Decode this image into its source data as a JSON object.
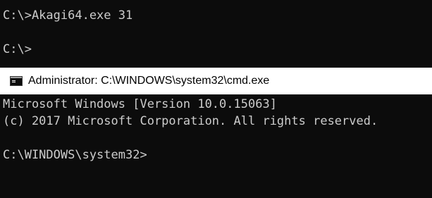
{
  "background_console": {
    "lines": [
      "C:\\>Akagi64.exe 31",
      "",
      "C:\\>"
    ]
  },
  "window": {
    "title": "Administrator: C:\\WINDOWS\\system32\\cmd.exe",
    "icon": "cmd-icon"
  },
  "console": {
    "lines": [
      "Microsoft Windows [Version 10.0.15063]",
      "(c) 2017 Microsoft Corporation. All rights reserved.",
      "",
      "C:\\WINDOWS\\system32>"
    ]
  },
  "colors": {
    "console_background": "#0c0c0c",
    "console_text": "#cccccc",
    "titlebar_background": "#ffffff",
    "titlebar_text": "#000000"
  }
}
